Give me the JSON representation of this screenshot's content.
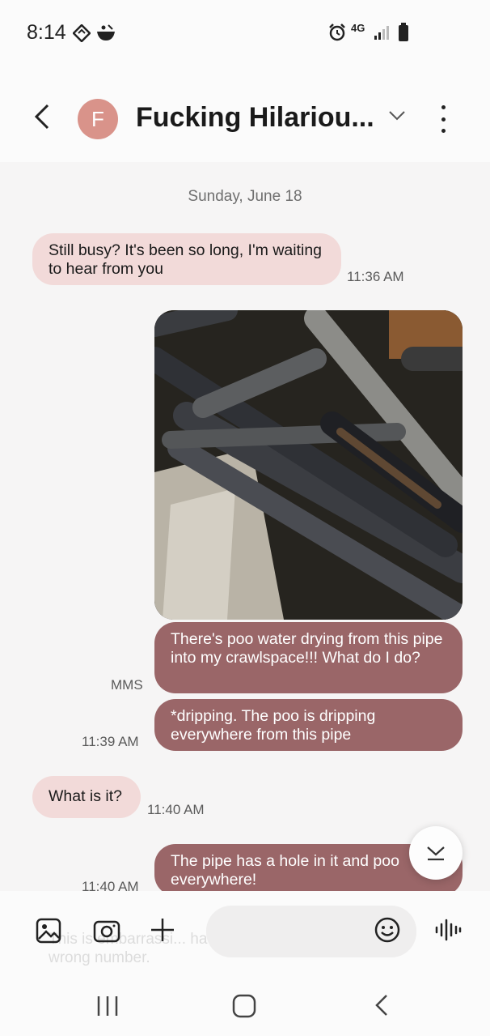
{
  "status_bar": {
    "time": "8:14",
    "network": "4G"
  },
  "header": {
    "avatar_letter": "F",
    "contact_name": "Fucking Hilariou..."
  },
  "conversation": {
    "date": "Sunday, June 18",
    "messages": [
      {
        "direction": "in",
        "text": "Still busy? It's been so long, I'm waiting to hear from you",
        "time": "11:36 AM"
      },
      {
        "direction": "out",
        "type": "image",
        "description": "photo-of-pipes"
      },
      {
        "direction": "out",
        "text": "There's poo water drying from this pipe into my crawlspace!!! What do I do?",
        "label": "MMS"
      },
      {
        "direction": "out",
        "text": "*dripping. The poo is dripping everywhere from this pipe",
        "time": "11:39 AM"
      },
      {
        "direction": "in",
        "text": "What is it?",
        "time": "11:40 AM"
      },
      {
        "direction": "out",
        "text": "The pipe has a hole in it and poo everywhere!",
        "time": "11:40 AM"
      }
    ],
    "ghost_text": "This is embarrassi... have entered the wrong number."
  },
  "composer": {
    "placeholder": ""
  }
}
